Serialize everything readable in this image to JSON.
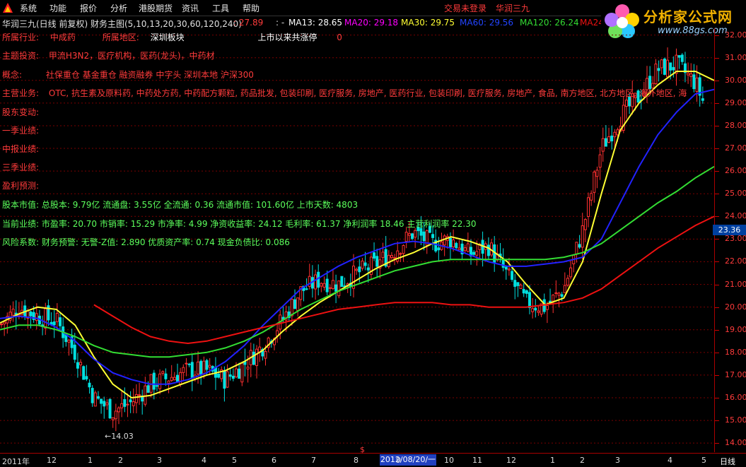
{
  "menu": {
    "items": [
      "系统",
      "功能",
      "报价",
      "分析",
      "港股期货",
      "资讯",
      "工具",
      "帮助"
    ],
    "trade_status": "交易未登录",
    "stock_name": "华润三九"
  },
  "brand": {
    "name": "分析家公式网",
    "url": "www.88gs.com"
  },
  "titlebar": {
    "main": "华润三九(日线 前复权) 财务主图(5,10,13,20,30,60,120,240)",
    "v1": ": 27.89",
    "v2": ": -",
    "ma13": "MA13: 28.65",
    "ma20": "MA20: 29.18",
    "ma30": "MA30: 29.75",
    "ma60": "MA60: 29.56",
    "ma120": "MA120: 26.24",
    "ma240": "MA24"
  },
  "info": {
    "industry_label": "所属行业:",
    "industry": "中成药",
    "region_label": "所属地区:",
    "region": "深圳板块",
    "limit_label": "上市以来共涨停",
    "limit_value": "0",
    "theme_label": "主题投资:",
    "theme": "甲流H3N2，医疗机构，医药(龙头)，中药材",
    "concept_label": "概念:",
    "concept": "社保重仓 基金重仓 融资融券 中字头 深圳本地 沪深300",
    "business_label": "主营业务:",
    "business": "OTC, 抗生素及原料药, 中药处方药, 中药配方颗粒, 药品批发, 包装印刷, 医疗服务, 房地产, 医药行业, 包装印刷, 医疗服务, 房地产, 食品, 南方地区, 北方地区, 海外地区, 海",
    "shareholder_label": "股东变动:",
    "q1_label": "一季业绩:",
    "mid_label": "中报业绩:",
    "q3_label": "三季业绩:",
    "forecast_label": "盈利预测:",
    "market_value": "股本市值: 总股本: 9.79亿 流通盘: 3.55亿 全流通: 0.36 流通市值: 101.60亿 上市天数: 4803",
    "performance": "当前业绩: 市盈率: 20.70 市销率: 15.29 市净率: 4.99 净资收益率: 24.12 毛利率: 61.37 净利润率 18.46 主营利润率 22.30",
    "risk": "风险系数: 财务预警: 无警-Z值: 2.890 优质资产率: 0.74 现金负债比: 0.086"
  },
  "chart_data": {
    "type": "candlestick",
    "y_ticks": [
      "32.00",
      "31.00",
      "30.00",
      "29.00",
      "28.00",
      "27.00",
      "26.00",
      "25.00",
      "24.00",
      "23.00",
      "22.00",
      "21.00",
      "20.00",
      "19.00",
      "18.00",
      "17.00",
      "16.00",
      "15.00",
      "14.00"
    ],
    "ylim": [
      13.6,
      32.3
    ],
    "current_price": "23.36",
    "low_marker": "←14.03",
    "x_labels": [
      "2011年",
      "12",
      "1",
      "2",
      "3",
      "4",
      "5",
      "6",
      "7",
      "8",
      "9",
      "10",
      "11",
      "12",
      "1",
      "2",
      "3",
      "4",
      "5"
    ],
    "cursor_date": "2012/08/20/一",
    "period": "日线",
    "colors": {
      "up": "#ff3030",
      "down": "#00e0e0",
      "ma5": "#ffffff",
      "ma10": "#ffff00",
      "ma20": "#ff00ff",
      "ma30": "#00ff00",
      "ma60": "#ffff33",
      "ma120": "#1a1aff",
      "ma240": "#33dd33",
      "ma250": "#ee1111"
    },
    "moving_averages": [
      {
        "name": "MA-yellow",
        "color": "#ffff33",
        "values": [
          19.3,
          19.7,
          20.0,
          19.9,
          19.2,
          17.8,
          16.6,
          16.0,
          16.1,
          16.4,
          16.7,
          17.0,
          17.2,
          17.6,
          18.1,
          18.9,
          19.6,
          20.2,
          20.7,
          21.2,
          21.7,
          22.1,
          22.4,
          22.8,
          23.1,
          22.9,
          22.6,
          22.0,
          21.0,
          20.1,
          20.4,
          22.0,
          25.0,
          27.8,
          29.0,
          29.8,
          30.4,
          30.4,
          30.0
        ]
      },
      {
        "name": "MA-blue",
        "color": "#2222ff",
        "values": [
          19.5,
          19.6,
          19.5,
          19.1,
          18.5,
          17.7,
          17.1,
          16.8,
          16.6,
          16.6,
          16.8,
          17.1,
          17.6,
          18.3,
          19.2,
          20.0,
          20.8,
          21.3,
          21.8,
          22.2,
          22.5,
          22.8,
          22.9,
          22.8,
          22.6,
          22.3,
          22.0,
          21.8,
          21.8,
          21.9,
          22.0,
          22.2,
          23.0,
          24.6,
          26.2,
          27.6,
          28.6,
          29.4,
          29.6
        ]
      },
      {
        "name": "MA-green",
        "color": "#33dd33",
        "values": [
          19.0,
          19.2,
          19.2,
          19.0,
          18.7,
          18.3,
          18.0,
          17.9,
          17.8,
          17.8,
          17.9,
          18.0,
          18.2,
          18.5,
          18.9,
          19.4,
          19.9,
          20.3,
          20.7,
          21.0,
          21.3,
          21.6,
          21.8,
          22.0,
          22.1,
          22.1,
          22.1,
          22.1,
          22.1,
          22.1,
          22.2,
          22.4,
          22.8,
          23.4,
          24.0,
          24.6,
          25.1,
          25.7,
          26.2
        ]
      },
      {
        "name": "MA-red",
        "color": "#ee1111",
        "values": [
          null,
          null,
          null,
          null,
          null,
          20.1,
          19.6,
          19.1,
          18.7,
          18.5,
          18.4,
          18.5,
          18.7,
          18.9,
          19.1,
          19.3,
          19.5,
          19.7,
          19.9,
          20.0,
          20.1,
          20.2,
          20.2,
          20.2,
          20.1,
          20.1,
          20.0,
          20.0,
          20.0,
          20.1,
          20.2,
          20.4,
          20.8,
          21.4,
          22.0,
          22.6,
          23.1,
          23.6,
          24.0
        ]
      }
    ],
    "closes": [
      19.2,
      20.0,
      19.6,
      19.4,
      18.0,
      16.0,
      15.4,
      15.8,
      16.6,
      16.9,
      17.2,
      17.2,
      16.8,
      17.5,
      18.3,
      19.4,
      20.7,
      21.2,
      21.0,
      21.5,
      21.9,
      22.5,
      23.3,
      22.8,
      23.0,
      22.3,
      22.7,
      21.4,
      20.2,
      20.0,
      20.8,
      23.4,
      27.0,
      28.4,
      29.3,
      30.5,
      30.7,
      29.9,
      27.9
    ]
  }
}
